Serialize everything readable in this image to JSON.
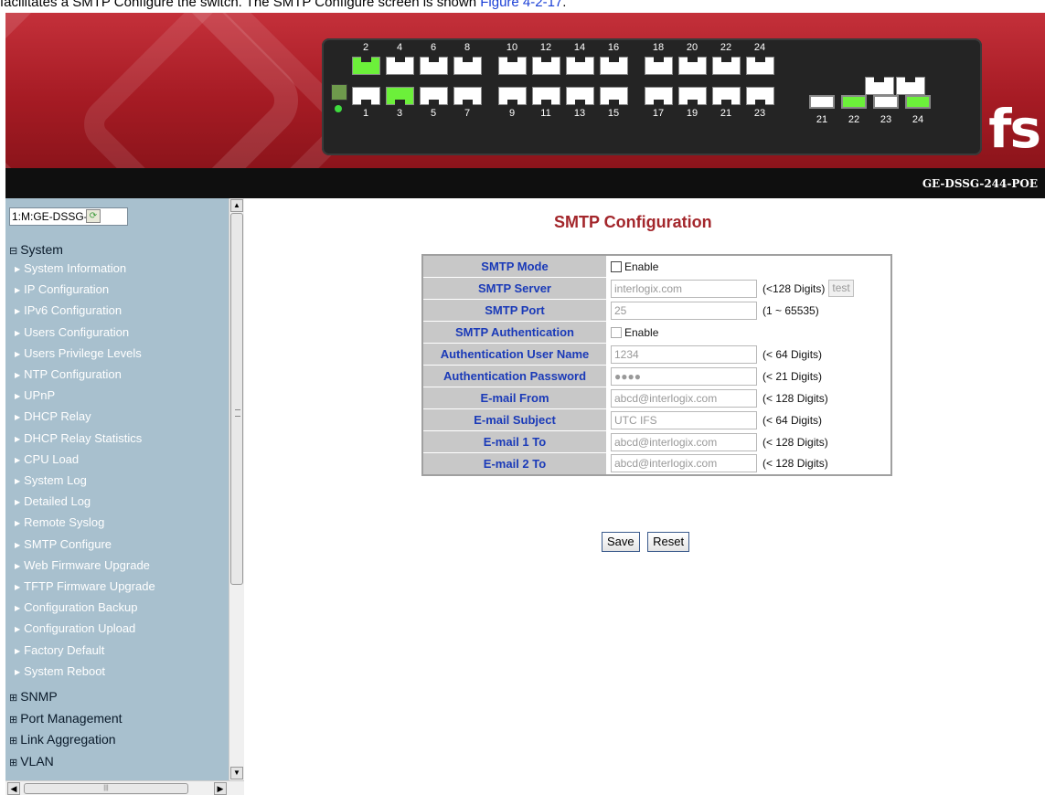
{
  "caption": {
    "text": "facilitates a SMTP Configure the switch. The SMTP Configure screen is shown ",
    "link": "Figure 4-2-17",
    "suffix": "."
  },
  "banner": {
    "logo": "fs",
    "model": "GE-DSSG-244-POE",
    "ports_top": [
      "2",
      "4",
      "6",
      "8",
      "10",
      "12",
      "14",
      "16",
      "18",
      "20",
      "22",
      "24"
    ],
    "ports_bottom": [
      "1",
      "3",
      "5",
      "7",
      "9",
      "11",
      "13",
      "15",
      "17",
      "19",
      "21",
      "23"
    ],
    "sfp_labels": [
      "21",
      "22",
      "23",
      "24"
    ],
    "active_ports": [
      "2",
      "3"
    ],
    "active_sfp": [
      "22",
      "24"
    ],
    "active_color": "#6cf03a"
  },
  "sidebar": {
    "device_select": "1:M:GE-DSSG-",
    "system_label": "System",
    "items": [
      "System Information",
      "IP Configuration",
      "IPv6 Configuration",
      "Users Configuration",
      "Users Privilege Levels",
      "NTP Configuration",
      "UPnP",
      "DHCP Relay",
      "DHCP Relay Statistics",
      "CPU Load",
      "System Log",
      "Detailed Log",
      "Remote Syslog",
      "SMTP Configure",
      "Web Firmware Upgrade",
      "TFTP Firmware Upgrade",
      "Configuration Backup",
      "Configuration Upload",
      "Factory Default",
      "System Reboot"
    ],
    "sections": [
      "SNMP",
      "Port Management",
      "Link Aggregation",
      "VLAN"
    ]
  },
  "main": {
    "title": "SMTP Configuration",
    "rows": [
      {
        "label": "SMTP Mode",
        "type": "checkbox",
        "check_label": "Enable"
      },
      {
        "label": "SMTP Server",
        "type": "text",
        "value": "interlogix.com",
        "hint": "(<128 Digits)",
        "button": "test"
      },
      {
        "label": "SMTP Port",
        "type": "text",
        "value": "25",
        "hint": "(1 ~ 65535)"
      },
      {
        "label": "SMTP Authentication",
        "type": "checkbox",
        "check_label": "Enable"
      },
      {
        "label": "Authentication User Name",
        "type": "text",
        "value": "1234",
        "hint": "(< 64 Digits)"
      },
      {
        "label": "Authentication Password",
        "type": "text",
        "value": "●●●●",
        "hint": "(< 21 Digits)"
      },
      {
        "label": "E-mail From",
        "type": "text",
        "value": "abcd@interlogix.com",
        "hint": "(< 128 Digits)"
      },
      {
        "label": "E-mail Subject",
        "type": "text",
        "value": "UTC IFS",
        "hint": "(< 64 Digits)"
      },
      {
        "label": "E-mail 1 To",
        "type": "text",
        "value": "abcd@interlogix.com",
        "hint": "(< 128 Digits)"
      },
      {
        "label": "E-mail 2 To",
        "type": "text",
        "value": "abcd@interlogix.com",
        "hint": "(< 128 Digits)"
      }
    ],
    "save_label": "Save",
    "reset_label": "Reset"
  }
}
